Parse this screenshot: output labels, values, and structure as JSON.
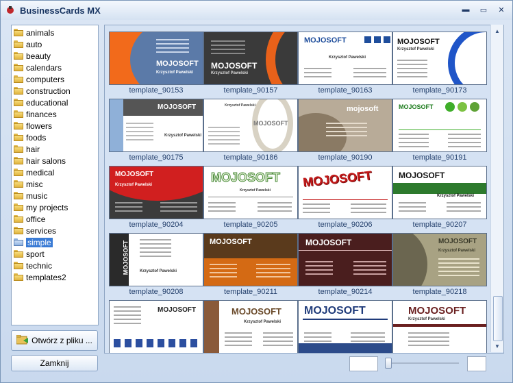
{
  "app": {
    "title": "BusinessCards MX"
  },
  "sidebar": {
    "selected": "simple",
    "items": [
      {
        "label": "animals"
      },
      {
        "label": "auto"
      },
      {
        "label": "beauty"
      },
      {
        "label": "calendars"
      },
      {
        "label": "computers"
      },
      {
        "label": "construction"
      },
      {
        "label": "educational"
      },
      {
        "label": "finances"
      },
      {
        "label": "flowers"
      },
      {
        "label": "foods"
      },
      {
        "label": "hair"
      },
      {
        "label": "hair salons"
      },
      {
        "label": "medical"
      },
      {
        "label": "misc"
      },
      {
        "label": "music"
      },
      {
        "label": "my projects"
      },
      {
        "label": "office"
      },
      {
        "label": "services"
      },
      {
        "label": "simple"
      },
      {
        "label": "sport"
      },
      {
        "label": "technic"
      },
      {
        "label": "templates2"
      }
    ]
  },
  "buttons": {
    "open_label": "Otwórz z pliku ...",
    "close_label": "Zamknij"
  },
  "templates": [
    {
      "name": "template_90153",
      "style": "orange-blue",
      "brand": "MOJOSOFT",
      "person": "Krzysztof Pawelski"
    },
    {
      "name": "template_90157",
      "style": "dark-orange",
      "brand": "MOJOSOFT",
      "person": "Krzysztof Pawelski"
    },
    {
      "name": "template_90163",
      "style": "white-blue-squares",
      "brand": "MOJOSOFT",
      "person": "Krzysztof Pawelski"
    },
    {
      "name": "template_90173",
      "style": "white-blue-swoosh",
      "brand": "MOJOSOFT",
      "person": "Krzysztof Pawelski"
    },
    {
      "name": "template_90175",
      "style": "grey-stripe",
      "brand": "MOJOSOFT",
      "person": "Krzysztof Pawelski"
    },
    {
      "name": "template_90186",
      "style": "floral",
      "brand": "MOJOSOFT",
      "person": "Krzysztof Pawelski"
    },
    {
      "name": "template_90190",
      "style": "beige-swirl",
      "brand": "mojosoft",
      "person": ""
    },
    {
      "name": "template_90191",
      "style": "green-dots",
      "brand": "MOJOSOFT",
      "person": ""
    },
    {
      "name": "template_90204",
      "style": "red-curve",
      "brand": "MOJOSOFT",
      "person": "Krzysztof Pawelski"
    },
    {
      "name": "template_90205",
      "style": "green-outline",
      "brand": "MOJOSOFT",
      "person": "Krzysztof Pawelski"
    },
    {
      "name": "template_90206",
      "style": "red-arc",
      "brand": "MOJOSOFT",
      "person": ""
    },
    {
      "name": "template_90207",
      "style": "green-bar",
      "brand": "MOJOSOFT",
      "person": "Krzysztof Pawelski"
    },
    {
      "name": "template_90208",
      "style": "black-side",
      "brand": "MOJOSOFT",
      "person": "Krzysztof Pawelski"
    },
    {
      "name": "template_90211",
      "style": "brown-orange",
      "brand": "MOJOSOFT",
      "person": ""
    },
    {
      "name": "template_90214",
      "style": "maroon",
      "brand": "MOJOSOFT",
      "person": ""
    },
    {
      "name": "template_90218",
      "style": "olive-curve",
      "brand": "MOJOSOFT",
      "person": "Krzysztof Pawelski"
    },
    {
      "name": "",
      "style": "blue-circles",
      "brand": "MOJOSOFT",
      "person": ""
    },
    {
      "name": "",
      "style": "brown-stripe",
      "brand": "MOJOSOFT",
      "person": "Krzysztof Pawelski"
    },
    {
      "name": "",
      "style": "navy-software",
      "brand": "MOJOSOFT",
      "person": ""
    },
    {
      "name": "",
      "style": "maroon-lines",
      "brand": "MOJOSOFT",
      "person": "Krzysztof Pawelski"
    }
  ],
  "colors": {
    "selection": "#3a7bd5",
    "label": "#25416d",
    "accent_orange": "#f26a1b",
    "accent_blue": "#1f4e9c"
  }
}
